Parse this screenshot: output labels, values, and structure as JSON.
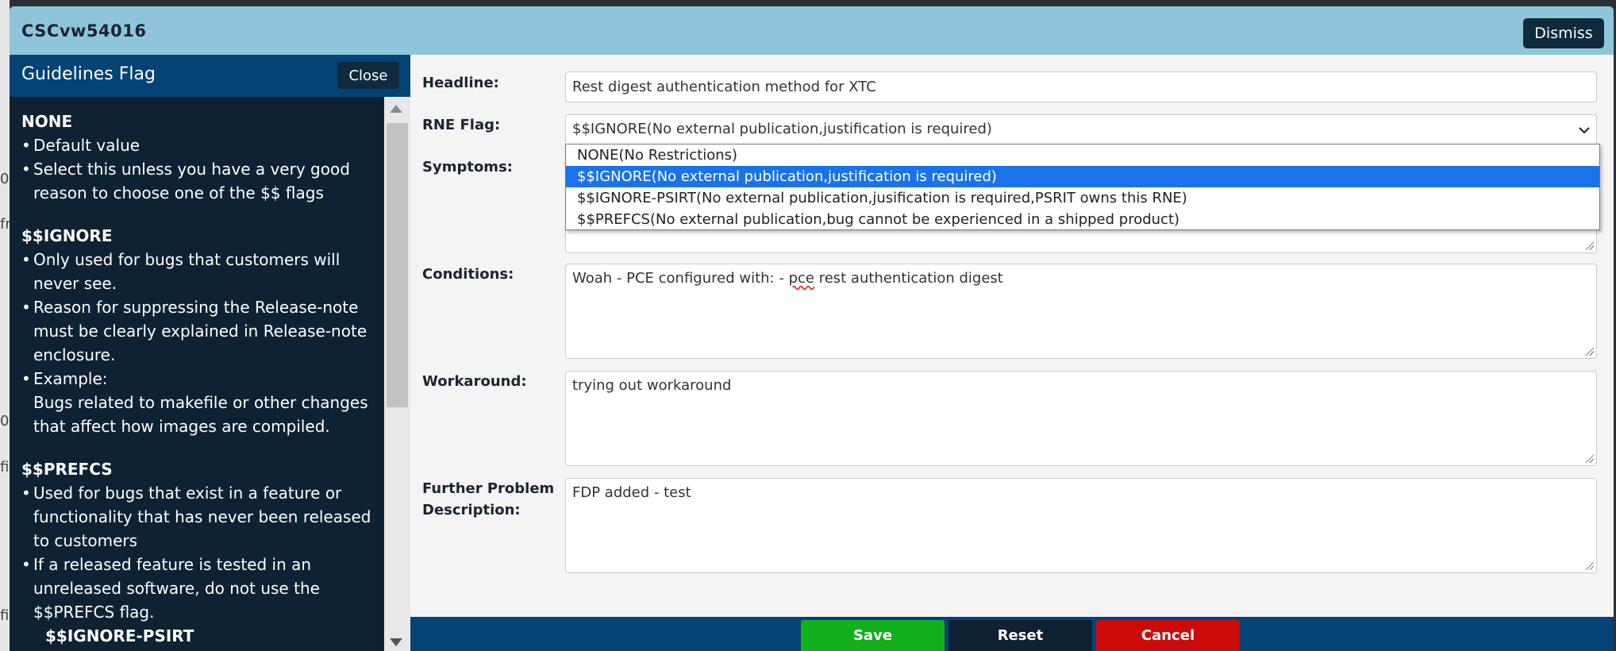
{
  "background": {
    "fragments": [
      "04",
      "fr",
      "01",
      "fi",
      "fi"
    ]
  },
  "modal": {
    "title": "CSCvw54016",
    "dismiss_label": "Dismiss"
  },
  "guidelines": {
    "title": "Guidelines Flag",
    "close_label": "Close",
    "sections": [
      {
        "heading": "NONE",
        "items": [
          "Default value",
          "Select this unless you have a very good reason to choose one of the $$ flags"
        ]
      },
      {
        "heading": "$$IGNORE",
        "items": [
          "Only used for bugs that customers will never see.",
          "Reason for suppressing the Release-note must be clearly explained in Release-note enclosure.",
          "Example:",
          "Bugs related to makefile or other changes that affect how images are compiled."
        ]
      },
      {
        "heading": "$$PREFCS",
        "items": [
          "Used for bugs that exist in a feature or functionality that has never been released to customers",
          "If a released feature is tested in an unreleased software, do not use the $$PREFCS flag."
        ],
        "sub": "$$IGNORE-PSIRT"
      }
    ]
  },
  "form": {
    "headline": {
      "label": "Headline:",
      "value": "Rest digest authentication method for XTC"
    },
    "rne_flag": {
      "label": "RNE Flag:",
      "value": "$$IGNORE(No external publication,justification is required)",
      "options": [
        "NONE(No Restrictions)",
        "$$IGNORE(No external publication,justification is required)",
        "$$IGNORE-PSIRT(No external publication,jusification is required,PSRIT owns this RNE)",
        "$$PREFCS(No external publication,bug cannot be experienced in a shipped product)"
      ],
      "selected_index": 1
    },
    "symptoms": {
      "label": "Symptoms:"
    },
    "conditions": {
      "label": "Conditions:",
      "value_before": "Woah - PCE configured with: - ",
      "value_misspelled": "pce",
      "value_after": " rest authentication digest"
    },
    "workaround": {
      "label": "Workaround:",
      "value": "trying out workaround"
    },
    "further": {
      "label_line1": "Further Problem",
      "label_line2": "Description:",
      "value": "FDP added - test"
    }
  },
  "footer": {
    "save_label": "Save",
    "reset_label": "Reset",
    "cancel_label": "Cancel"
  }
}
